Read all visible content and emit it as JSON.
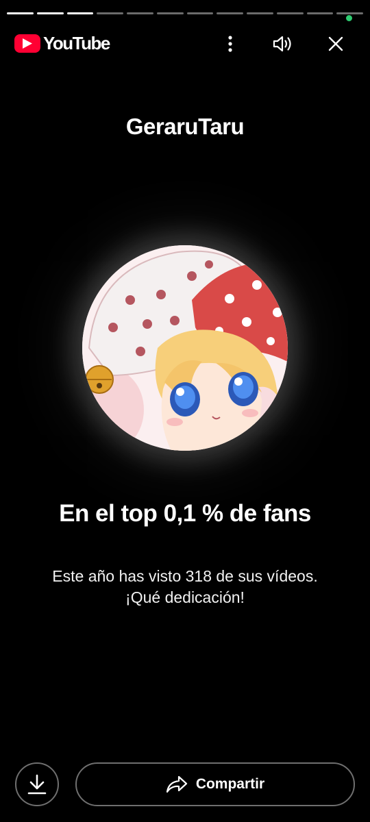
{
  "progress": {
    "total_segments": 12,
    "completed_segments": 3
  },
  "header": {
    "brand": "YouTube",
    "icons": {
      "more": "more-vert-icon",
      "sound": "volume-icon",
      "close": "close-icon"
    }
  },
  "channel": {
    "name": "GeraruTaru",
    "avatar": "channel-avatar-image"
  },
  "card": {
    "headline": "En el top 0,1 % de fans",
    "description_line1": "Este año has visto 318 de sus vídeos.",
    "description_line2": "¡Qué dedicación!"
  },
  "actions": {
    "download_icon": "download-icon",
    "share_icon": "share-icon",
    "share_label": "Compartir"
  },
  "colors": {
    "background": "#000000",
    "brand_red": "#ff0033",
    "text": "#ffffff",
    "status_dot": "#2ecc71",
    "button_border": "#6f6f6f"
  }
}
